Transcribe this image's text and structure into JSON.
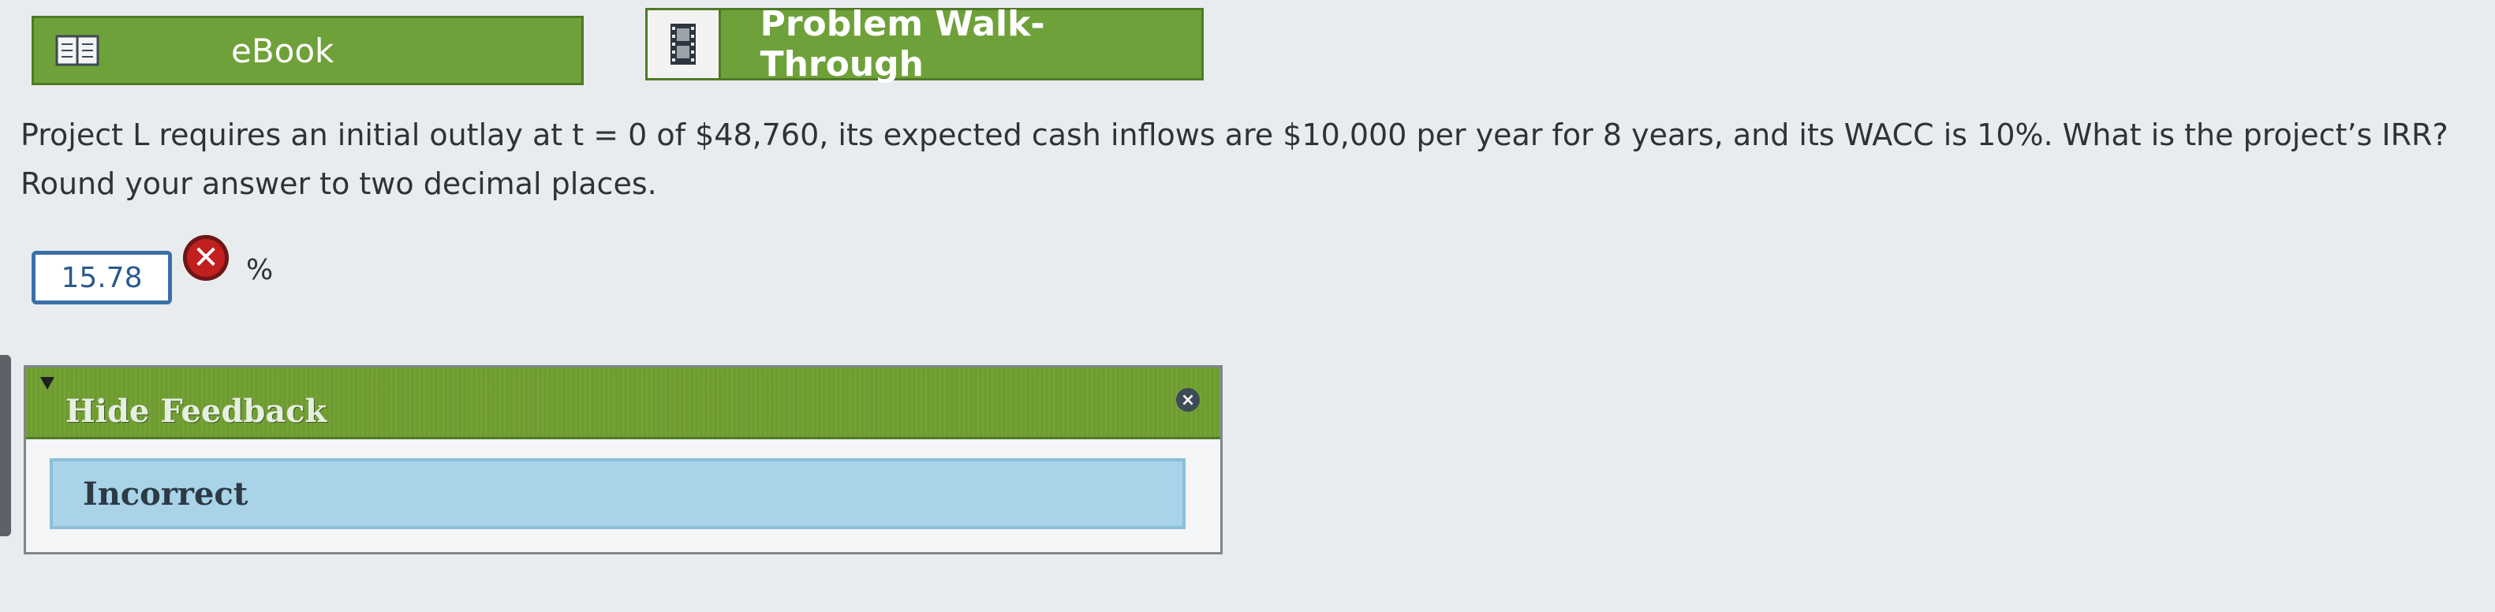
{
  "toolbar": {
    "ebook_label": "eBook",
    "walkthrough_label": "Problem Walk-Through"
  },
  "question": {
    "line1": "Project L requires an initial outlay at t = 0 of $48,760, its expected cash inflows are $10,000 per year for 8 years, and its WACC is 10%. What is the project’s IRR?",
    "line2": "Round your answer to two decimal places."
  },
  "answer": {
    "value": "15.78",
    "unit": "%",
    "status_icon": "incorrect-x-icon"
  },
  "feedback": {
    "toggle_label": "Hide Feedback",
    "message": "Incorrect",
    "close_glyph": "×"
  },
  "colors": {
    "button_green": "#6fa13a",
    "error_red": "#c21f1f",
    "feedback_blue": "#a8d3e8",
    "input_border_blue": "#3b6fa8"
  }
}
